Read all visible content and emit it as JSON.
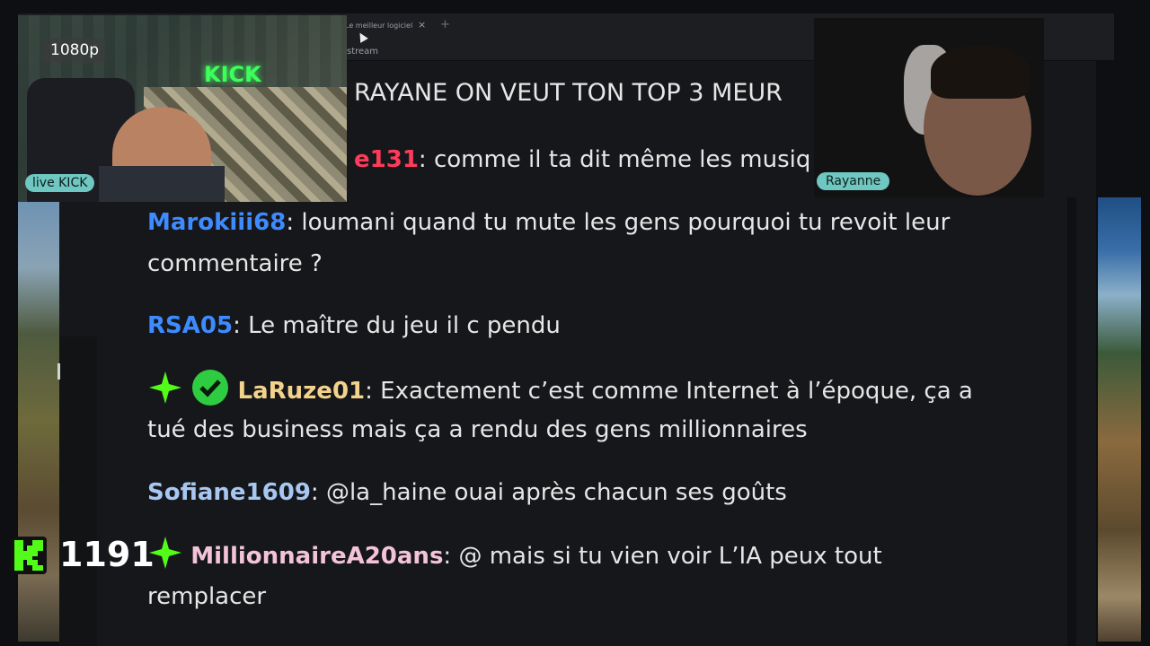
{
  "browser": {
    "tab_title": "Le meilleur logiciel",
    "tab_close": "×",
    "tab_new": "+",
    "address_fragment": "stream"
  },
  "headline": "RAYANE ON VEUT TON TOP 3 MEUR",
  "chat": {
    "messages": [
      {
        "user": "e131",
        "user_color": "#ff3b5c",
        "text": "comme il ta dit même les musiq"
      },
      {
        "user": "Marokiii68",
        "user_color": "#3d8bff",
        "text": "loumani quand tu mute les gens pourquoi tu revoit leur",
        "text2": "commentaire ?"
      },
      {
        "user": "RSA05",
        "user_color": "#3d8bff",
        "text": "Le maître du jeu il c pendu"
      },
      {
        "user": "LaRuze01",
        "user_color": "#f3d38c",
        "text": "Exactement c’est comme Internet à l’époque, ça a",
        "text2": "tué des business mais ça a rendu des gens millionnaires"
      },
      {
        "user": "Sofiane1609",
        "user_color": "#a7c7f2",
        "text": "@la_haine ouai après chacun ses goûts"
      },
      {
        "user": "MillionnaireA20ans",
        "user_color": "#f3c4d8",
        "text": "@ mais si tu vien voir L’IA peux tout",
        "text2": "remplacer"
      }
    ]
  },
  "overlay": {
    "quality": "1080p",
    "cam1_label": "live KICK",
    "cam2_label": "Rayanne",
    "viewer_count": "1191",
    "neon_text": "KICK",
    "accent": "#53fc18"
  }
}
